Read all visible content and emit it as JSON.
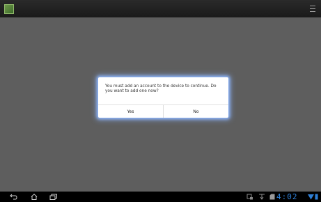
{
  "dialog": {
    "message": "You must add an account to the device to continue. Do you want to add one now?",
    "yes_label": "Yes",
    "no_label": "No"
  },
  "status_bar": {
    "time": "4:02"
  },
  "colors": {
    "background": "#5e5e5e",
    "accent": "#2e7fd6",
    "dialog_glow": "#8fb8ff"
  },
  "icons": [
    "app-icon",
    "menu-icon",
    "back-icon",
    "home-icon",
    "recent-apps-icon",
    "screenshot-icon",
    "usb-icon",
    "sd-card-icon",
    "wifi-icon",
    "battery-icon"
  ]
}
